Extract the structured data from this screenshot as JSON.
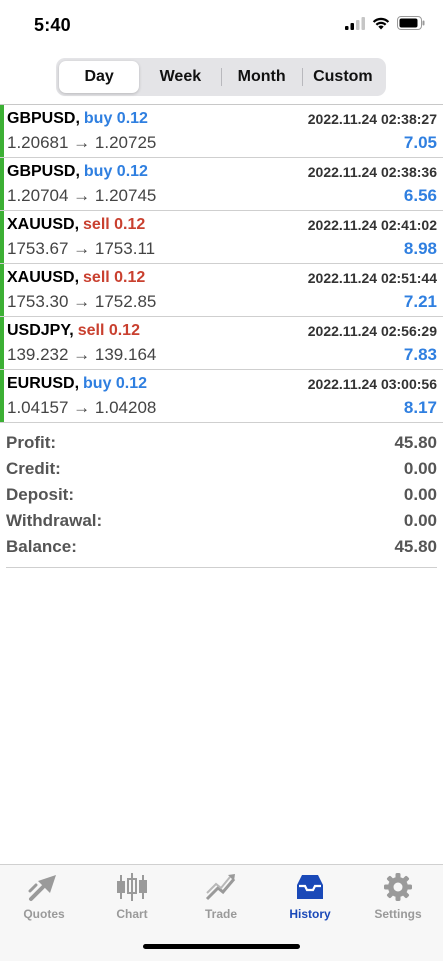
{
  "status": {
    "time": "5:40"
  },
  "periods": [
    {
      "label": "Day",
      "active": true
    },
    {
      "label": "Week",
      "active": false
    },
    {
      "label": "Month",
      "active": false
    },
    {
      "label": "Custom",
      "active": false
    }
  ],
  "trades": [
    {
      "symbol": "GBPUSD,",
      "side": "buy 0.12",
      "time": "2022.11.24 02:38:27",
      "prices": "1.20681 → 1.20725",
      "profit": "7.05"
    },
    {
      "symbol": "GBPUSD,",
      "side": "buy 0.12",
      "time": "2022.11.24 02:38:36",
      "prices": "1.20704 → 1.20745",
      "profit": "6.56"
    },
    {
      "symbol": "XAUUSD,",
      "side": "sell 0.12",
      "time": "2022.11.24 02:41:02",
      "prices": "1753.67 → 1753.11",
      "profit": "8.98"
    },
    {
      "symbol": "XAUUSD,",
      "side": "sell 0.12",
      "time": "2022.11.24 02:51:44",
      "prices": "1753.30 → 1752.85",
      "profit": "7.21"
    },
    {
      "symbol": "USDJPY,",
      "side": "sell 0.12",
      "time": "2022.11.24 02:56:29",
      "prices": "139.232 → 139.164",
      "profit": "7.83"
    },
    {
      "symbol": "EURUSD,",
      "side": "buy 0.12",
      "time": "2022.11.24 03:00:56",
      "prices": "1.04157 → 1.04208",
      "profit": "8.17"
    }
  ],
  "summary": [
    {
      "label": "Profit:",
      "value": "45.80"
    },
    {
      "label": "Credit:",
      "value": "0.00"
    },
    {
      "label": "Deposit:",
      "value": "0.00"
    },
    {
      "label": "Withdrawal:",
      "value": "0.00"
    },
    {
      "label": "Balance:",
      "value": "45.80"
    }
  ],
  "tabs": [
    {
      "label": "Quotes",
      "icon": "quotes-icon",
      "active": false
    },
    {
      "label": "Chart",
      "icon": "chart-icon",
      "active": false
    },
    {
      "label": "Trade",
      "icon": "trade-icon",
      "active": false
    },
    {
      "label": "History",
      "icon": "history-icon",
      "active": true
    },
    {
      "label": "Settings",
      "icon": "gear-icon",
      "active": false
    }
  ],
  "colors": {
    "buy": "#2f7fe0",
    "sell": "#c9402f",
    "accent": "#1a49b8",
    "row_bar": "#3cb034"
  }
}
